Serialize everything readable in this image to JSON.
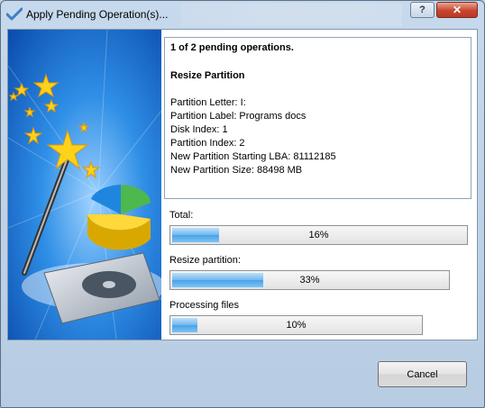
{
  "window": {
    "title": "Apply Pending Operation(s)...",
    "help_glyph": "?",
    "close_glyph": "✕"
  },
  "info": {
    "headline": "1 of 2 pending operations.",
    "operation": "Resize Partition",
    "details": [
      "Partition Letter: I:",
      "Partition Label: Programs docs",
      "Disk Index: 1",
      "Partition Index: 2",
      "New Partition Starting LBA: 81112185",
      "New Partition Size: 88498 MB"
    ]
  },
  "progress": [
    {
      "label": "Total:",
      "percent": 16,
      "text": "16%"
    },
    {
      "label": "Resize partition:",
      "percent": 33,
      "text": "33%"
    },
    {
      "label": "Processing files",
      "percent": 10,
      "text": "10%"
    }
  ],
  "buttons": {
    "cancel": "Cancel"
  },
  "colors": {
    "progress_fill": "#4aa2e6",
    "art_background": "#1a78d2"
  }
}
